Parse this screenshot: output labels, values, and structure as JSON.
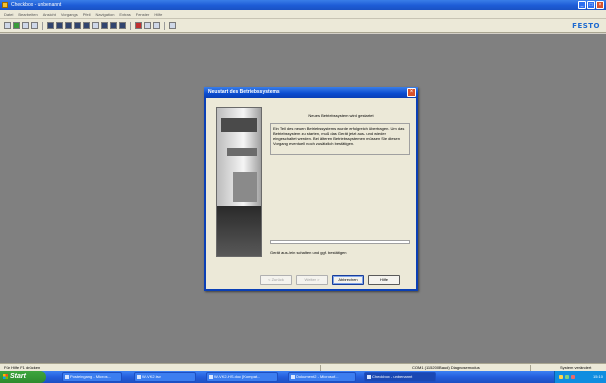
{
  "window": {
    "title": "Checkbox - unbenannt"
  },
  "menubar": {
    "items": [
      "Datei",
      "Bearbeiten",
      "Ansicht",
      "Vorgangs",
      "Pfeil",
      "Navigation",
      "Extras",
      "Fenster",
      "Hilfe"
    ]
  },
  "toolbar": {
    "brand": "FESTO"
  },
  "dialog": {
    "title": "Neustart des Betriebssystems",
    "heading": "Neues Betriebssystem wird gestartet",
    "message": "Ein Teil des neuen Betriebssystems wurde erfolgreich übertragen. Um das Betriebssystem zu starten, muß das Gerät jetzt aus- und wieder eingeschaltet werden. Bei älteren Betriebssystemen müssen Sie diesen Vorgang eventuell noch zusätzlich bestätigen.",
    "status": "Gerät aus-/ein schalten und ggf. bestätigen",
    "progress": 0,
    "buttons": {
      "back": "< Zurück",
      "next": "Weiter >",
      "cancel": "Abbrechen",
      "help": "Hilfe"
    }
  },
  "statusbar": {
    "help": "Für Hilfe F1 drücken",
    "connection": "COM1 (115200Baud) Diagnosemodus",
    "system": "System verändert"
  },
  "taskbar": {
    "start": "Start",
    "tasks": [
      "Posteingang - Micros...",
      "W-VK2.tsv",
      "W-VK2-HS.doc [Kompat...",
      "Dokument2 - Microsof...",
      "Checkbox - unbenannt"
    ],
    "clock": "15:10"
  }
}
